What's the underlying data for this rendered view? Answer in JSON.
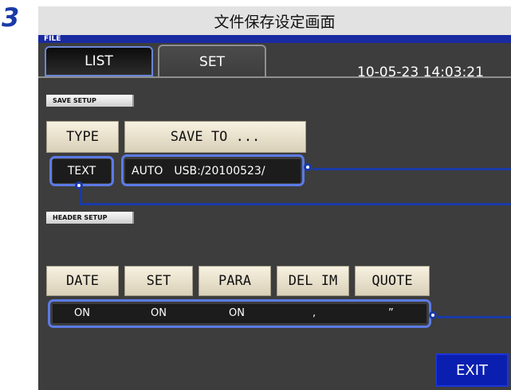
{
  "step_number": "3",
  "caption": "文件保存设定画面",
  "screen": {
    "file_label": "FILE",
    "tabs": [
      {
        "label": "LIST",
        "active": true
      },
      {
        "label": "SET",
        "active": false
      }
    ],
    "datetime": "10-05-23 14:03:21",
    "save_setup": {
      "section_label": "SAVE SETUP",
      "type_button": "TYPE",
      "save_to_button": "SAVE TO ...",
      "type_value": "TEXT",
      "save_mode": "AUTO",
      "save_path": "USB:/20100523/"
    },
    "header_setup": {
      "section_label": "HEADER SETUP",
      "buttons": [
        "DATE",
        "SET",
        "PARA",
        "DEL IM",
        "QUOTE"
      ],
      "values": [
        "ON",
        "ON",
        "ON",
        ",",
        "”"
      ]
    },
    "exit_button": "EXIT"
  },
  "colors": {
    "accent_blue": "#1a3aa8",
    "screen_bg": "#3d3d3d",
    "highlight_border": "#5b7be6",
    "exit_bg": "#0a1fb0"
  }
}
